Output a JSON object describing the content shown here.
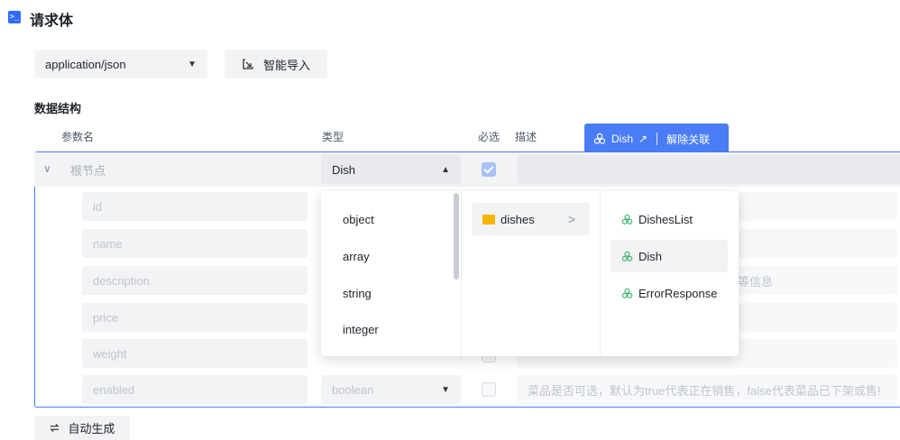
{
  "section": {
    "icon": "terminal-icon",
    "title": "请求体"
  },
  "content_type": {
    "value": "application/json"
  },
  "import_button": {
    "label": "智能导入",
    "icon": "import-icon"
  },
  "structure": {
    "title": "数据结构",
    "headers": {
      "name": "参数名",
      "type": "类型",
      "required": "必选",
      "description": "描述"
    }
  },
  "schema_tag": {
    "name": "Dish",
    "icon": "schema-icon",
    "unlink_label": "解除关联",
    "accent": "#4a7cf6"
  },
  "root_row": {
    "label": "根节点",
    "type": "Dish",
    "required": true
  },
  "fields": [
    {
      "name": "id",
      "type": "",
      "description": ""
    },
    {
      "name": "name",
      "type": "",
      "description": ""
    },
    {
      "name": "description",
      "type": "",
      "description": "等信息"
    },
    {
      "name": "price",
      "type": "",
      "description": ""
    },
    {
      "name": "weight",
      "type": "",
      "description": ""
    },
    {
      "name": "enabled",
      "type": "boolean",
      "description": "菜品是否可选，默认为true代表正在销售，false代表菜品已下架或售!"
    }
  ],
  "dropdown": {
    "types": [
      "object",
      "array",
      "string",
      "integer"
    ],
    "folder": {
      "name": "dishes"
    },
    "schemas": [
      {
        "name": "DishesList",
        "selected": false
      },
      {
        "name": "Dish",
        "selected": true
      },
      {
        "name": "ErrorResponse",
        "selected": false
      }
    ]
  },
  "auto_generate": {
    "label": "自动生成",
    "icon": "refresh-icon"
  }
}
